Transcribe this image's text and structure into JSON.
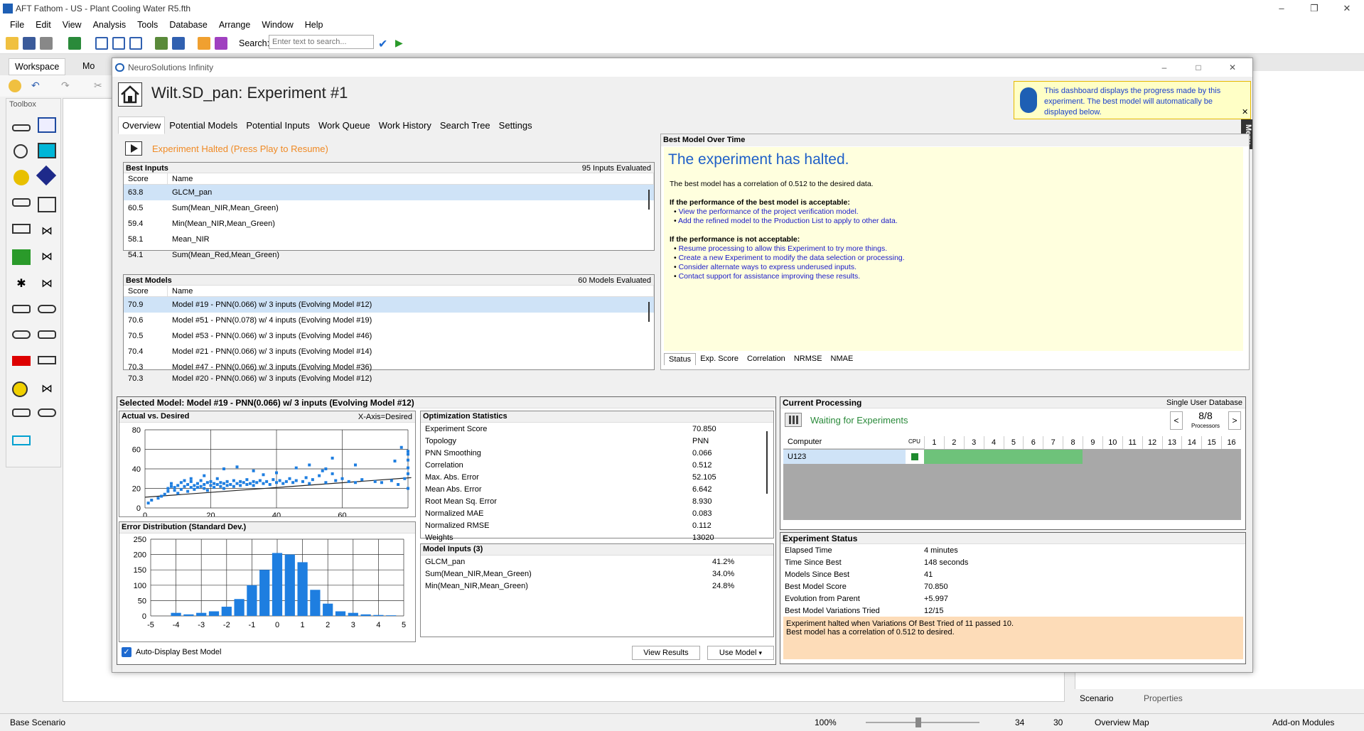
{
  "app": {
    "title": "AFT Fathom - US - Plant Cooling Water R5.fth",
    "menu": [
      "File",
      "Edit",
      "View",
      "Analysis",
      "Tools",
      "Database",
      "Arrange",
      "Window",
      "Help"
    ],
    "search_label": "Search:",
    "search_placeholder": "Enter text to search...",
    "tab_workspace": "Workspace",
    "tab_model": "Mo",
    "toolbox_title": "Toolbox",
    "status_left": "Base Scenario",
    "zoom": "100%",
    "count_a": "34",
    "count_b": "30",
    "right_tab_scenario": "Scenario",
    "right_tab_properties": "Properties",
    "overview_map": "Overview Map",
    "addon_modules": "Add-on Modules"
  },
  "ns": {
    "window_title": "NeuroSolutions Infinity",
    "experiment_title": "Wilt.SD_pan:  Experiment #1",
    "info_text": "This dashboard displays the progress made by this experiment. The best model will automatically be displayed below.",
    "menu_strip": "Menu",
    "tabs": [
      "Overview",
      "Potential Models",
      "Potential Inputs",
      "Work Queue",
      "Work History",
      "Search Tree",
      "Settings"
    ],
    "halted_msg": "Experiment Halted (Press Play to Resume)",
    "best_inputs": {
      "title": "Best Inputs",
      "count": "95 Inputs Evaluated",
      "col_score": "Score",
      "col_name": "Name",
      "rows": [
        {
          "score": "63.8",
          "name": "GLCM_pan"
        },
        {
          "score": "60.5",
          "name": "Sum(Mean_NIR,Mean_Green)"
        },
        {
          "score": "59.4",
          "name": "Min(Mean_NIR,Mean_Green)"
        },
        {
          "score": "58.1",
          "name": "Mean_NIR"
        },
        {
          "score": "54.1",
          "name": "Sum(Mean_Red,Mean_Green)"
        }
      ]
    },
    "best_models": {
      "title": "Best Models",
      "count": "60 Models Evaluated",
      "col_score": "Score",
      "col_name": "Name",
      "rows": [
        {
          "score": "70.9",
          "name": "Model #19 - PNN(0.066) w/ 3 inputs (Evolving Model #12)"
        },
        {
          "score": "70.6",
          "name": "Model #51 - PNN(0.078) w/ 4 inputs (Evolving Model #19)"
        },
        {
          "score": "70.5",
          "name": "Model #53 - PNN(0.066) w/ 3 inputs (Evolving Model #46)"
        },
        {
          "score": "70.4",
          "name": "Model #21 - PNN(0.066) w/ 3 inputs (Evolving Model #14)"
        },
        {
          "score": "70.3",
          "name": "Model #47 - PNN(0.066) w/ 3 inputs (Evolving Model #36)"
        },
        {
          "score": "70.3",
          "name": "Model #20 - PNN(0.066) w/ 3 inputs (Evolving Model #12)"
        }
      ]
    },
    "best_model_over_time": {
      "title": "Best Model Over Time",
      "heading": "The experiment has halted.",
      "correlation_line": "The best model has a correlation of 0.512 to the desired data.",
      "acceptable_heading": "If the performance of the best model is acceptable:",
      "acceptable_links": [
        "View the performance of the project verification model.",
        "Add the refined model to the Production List to apply to other data."
      ],
      "not_acceptable_heading": "If the performance is not acceptable:",
      "not_acceptable_links": [
        "Resume processing to allow this Experiment to try more things.",
        "Create a new Experiment to modify the data selection or processing.",
        "Consider alternate ways to express underused inputs.",
        "Contact support for assistance improving these results."
      ],
      "tabs": [
        "Status",
        "Exp. Score",
        "Correlation",
        "NRMSE",
        "NMAE"
      ]
    },
    "selected_model": {
      "title": "Selected Model: Model #19 - PNN(0.066) w/ 3 inputs (Evolving Model #12)",
      "avd_title": "Actual vs. Desired",
      "avd_axis_note": "X-Axis=Desired",
      "err_title": "Error Distribution (Standard Dev.)",
      "auto_display": "Auto-Display Best Model",
      "view_results": "View Results",
      "use_model": "Use Model"
    },
    "optimization_statistics": {
      "title": "Optimization Statistics",
      "rows": [
        {
          "k": "Experiment Score",
          "v": "70.850"
        },
        {
          "k": "Topology",
          "v": "PNN"
        },
        {
          "k": "PNN Smoothing",
          "v": "0.066"
        },
        {
          "k": "Correlation",
          "v": "0.512"
        },
        {
          "k": "Max. Abs. Error",
          "v": "52.105"
        },
        {
          "k": "Mean Abs. Error",
          "v": "6.642"
        },
        {
          "k": "Root Mean Sq. Error",
          "v": "8.930"
        },
        {
          "k": "Normalized MAE",
          "v": "0.083"
        },
        {
          "k": "Normalized RMSE",
          "v": "0.112"
        },
        {
          "k": "Weights",
          "v": "13020"
        }
      ]
    },
    "model_inputs": {
      "title": "Model Inputs (3)",
      "rows": [
        {
          "k": "GLCM_pan",
          "v": "41.2%"
        },
        {
          "k": "Sum(Mean_NIR,Mean_Green)",
          "v": "34.0%"
        },
        {
          "k": "Min(Mean_NIR,Mean_Green)",
          "v": "24.8%"
        }
      ]
    },
    "current_processing": {
      "title": "Current Processing",
      "db": "Single User Database",
      "status": "Waiting for Experiments",
      "processors": "8/8",
      "processors_label": "Processors",
      "col_computer": "Computer",
      "col_cpu": "CPU",
      "computer": "U123",
      "proc_numbers": [
        "1",
        "2",
        "3",
        "4",
        "5",
        "6",
        "7",
        "8",
        "9",
        "10",
        "11",
        "12",
        "13",
        "14",
        "15",
        "16"
      ],
      "busy_fraction": 0.5
    },
    "experiment_status": {
      "title": "Experiment Status",
      "rows": [
        {
          "k": "Elapsed Time",
          "v": "4 minutes"
        },
        {
          "k": "Time Since Best",
          "v": "148 seconds"
        },
        {
          "k": "Models Since Best",
          "v": "41"
        },
        {
          "k": "Best Model Score",
          "v": "70.850"
        },
        {
          "k": "Evolution from Parent",
          "v": "+5.997"
        },
        {
          "k": "Best Model Variations Tried",
          "v": "12/15"
        }
      ],
      "message_1": "Experiment halted when Variations Of Best Tried of 11 passed 10.",
      "message_2": "Best model has a correlation of 0.512 to desired."
    }
  },
  "chart_data": [
    {
      "type": "scatter",
      "title": "Actual vs. Desired",
      "xlabel": "X-Axis=Desired",
      "xlim": [
        0,
        80
      ],
      "ylim": [
        0,
        80
      ],
      "xticks": [
        "0",
        "20",
        "40",
        "60"
      ],
      "yticks": [
        "80",
        "60",
        "40",
        "20",
        "0"
      ],
      "grid": true,
      "trend_line": {
        "x": [
          0,
          81
        ],
        "y": [
          11,
          31
        ]
      },
      "points": [
        [
          1,
          5
        ],
        [
          2,
          8
        ],
        [
          4,
          10
        ],
        [
          5,
          12
        ],
        [
          6,
          14
        ],
        [
          7,
          17
        ],
        [
          7,
          20
        ],
        [
          8,
          22
        ],
        [
          8,
          25
        ],
        [
          9,
          18
        ],
        [
          9,
          21
        ],
        [
          10,
          15
        ],
        [
          10,
          23
        ],
        [
          11,
          26
        ],
        [
          11,
          19
        ],
        [
          12,
          22
        ],
        [
          12,
          28
        ],
        [
          13,
          17
        ],
        [
          13,
          24
        ],
        [
          14,
          21
        ],
        [
          14,
          27
        ],
        [
          15,
          23
        ],
        [
          15,
          19
        ],
        [
          16,
          25
        ],
        [
          16,
          21
        ],
        [
          17,
          22
        ],
        [
          17,
          28
        ],
        [
          18,
          20
        ],
        [
          18,
          24
        ],
        [
          19,
          26
        ],
        [
          19,
          18
        ],
        [
          20,
          23
        ],
        [
          20,
          27
        ],
        [
          21,
          21
        ],
        [
          21,
          25
        ],
        [
          22,
          24
        ],
        [
          22,
          30
        ],
        [
          23,
          22
        ],
        [
          23,
          26
        ],
        [
          24,
          20
        ],
        [
          24,
          25
        ],
        [
          25,
          27
        ],
        [
          25,
          23
        ],
        [
          26,
          24
        ],
        [
          27,
          28
        ],
        [
          27,
          22
        ],
        [
          28,
          25
        ],
        [
          29,
          23
        ],
        [
          29,
          27
        ],
        [
          30,
          26
        ],
        [
          31,
          24
        ],
        [
          31,
          29
        ],
        [
          32,
          25
        ],
        [
          33,
          27
        ],
        [
          33,
          23
        ],
        [
          34,
          26
        ],
        [
          35,
          28
        ],
        [
          36,
          25
        ],
        [
          37,
          27
        ],
        [
          38,
          24
        ],
        [
          39,
          29
        ],
        [
          40,
          26
        ],
        [
          41,
          28
        ],
        [
          42,
          25
        ],
        [
          43,
          27
        ],
        [
          44,
          30
        ],
        [
          45,
          26
        ],
        [
          46,
          28
        ],
        [
          48,
          27
        ],
        [
          49,
          31
        ],
        [
          50,
          25
        ],
        [
          51,
          29
        ],
        [
          53,
          33
        ],
        [
          54,
          38
        ],
        [
          55,
          26
        ],
        [
          57,
          35
        ],
        [
          58,
          28
        ],
        [
          60,
          30
        ],
        [
          62,
          27
        ],
        [
          64,
          26
        ],
        [
          66,
          29
        ],
        [
          70,
          27
        ],
        [
          72,
          26
        ],
        [
          75,
          28
        ],
        [
          77,
          24
        ],
        [
          79,
          30
        ],
        [
          80,
          20
        ],
        [
          80,
          41
        ],
        [
          80,
          58
        ],
        [
          80,
          49
        ],
        [
          80,
          35
        ],
        [
          80,
          55
        ],
        [
          78,
          62
        ],
        [
          76,
          48
        ],
        [
          28,
          42
        ],
        [
          33,
          38
        ],
        [
          36,
          34
        ],
        [
          46,
          41
        ],
        [
          55,
          40
        ],
        [
          64,
          44
        ],
        [
          57,
          51
        ],
        [
          50,
          44
        ],
        [
          40,
          36
        ],
        [
          24,
          40
        ],
        [
          18,
          33
        ],
        [
          14,
          30
        ]
      ]
    },
    {
      "type": "bar",
      "title": "Error Distribution (Standard Dev.)",
      "xlim": [
        -5,
        5
      ],
      "ylim": [
        0,
        250
      ],
      "xticks": [
        "-5",
        "-4",
        "-3",
        "-2",
        "-1",
        "0",
        "1",
        "2",
        "3",
        "4",
        "5"
      ],
      "yticks": [
        "250",
        "200",
        "150",
        "100",
        "50",
        "0"
      ],
      "grid": true,
      "bins": [
        -4.5,
        -4,
        -3.5,
        -3,
        -2.5,
        -2,
        -1.5,
        -1,
        -0.5,
        0,
        0.5,
        1,
        1.5,
        2,
        2.5,
        3,
        3.5,
        4,
        4.5
      ],
      "values": [
        0,
        10,
        5,
        10,
        15,
        30,
        55,
        100,
        150,
        205,
        200,
        175,
        85,
        40,
        15,
        10,
        5,
        3,
        2
      ]
    }
  ]
}
